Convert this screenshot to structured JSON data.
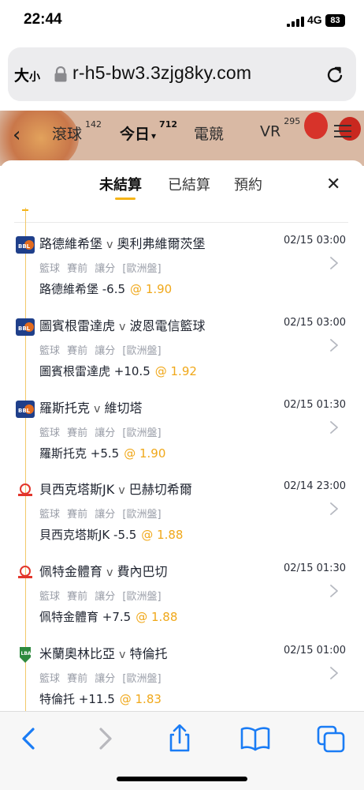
{
  "status": {
    "time": "22:44",
    "network": "4G",
    "battery": "83"
  },
  "browser": {
    "text_size_big": "大",
    "text_size_small": "小",
    "url": "r-h5-bw3.3zjg8ky.com"
  },
  "app_nav": {
    "tabs": [
      {
        "label": "滾球",
        "count": "142"
      },
      {
        "label": "今日",
        "count": "712"
      },
      {
        "label": "電競",
        "count": ""
      },
      {
        "label": "VR",
        "count": "295"
      }
    ]
  },
  "sheet": {
    "tabs": [
      "未結算",
      "已結算",
      "預約"
    ],
    "close": "✕",
    "bets": [
      {
        "home": "路德維希堡",
        "sep": "v",
        "away": "奧利弗維爾茨堡",
        "date": "02/15 03:00",
        "meta": "籃球 賽前 讓分 [歐洲盤]",
        "pick": "路德維希堡 -6.5",
        "odds": "@ 1.90",
        "logo": "bbl-logo"
      },
      {
        "home": "圖賓根雷達虎",
        "sep": "v",
        "away": "波恩電信籃球",
        "date": "02/15 03:00",
        "meta": "籃球 賽前 讓分 [歐洲盤]",
        "pick": "圖賓根雷達虎 +10.5",
        "odds": "@ 1.92",
        "logo": "bbl-logo"
      },
      {
        "home": "羅斯托克",
        "sep": "v",
        "away": "維切塔",
        "date": "02/15 01:30",
        "meta": "籃球 賽前 讓分 [歐洲盤]",
        "pick": "羅斯托克 +5.5",
        "odds": "@ 1.90",
        "logo": "bbl-logo"
      },
      {
        "home": "貝西克塔斯JK",
        "sep": "v",
        "away": "巴赫切希爾",
        "date": "02/14 23:00",
        "meta": "籃球 賽前 讓分 [歐洲盤]",
        "pick": "貝西克塔斯JK -5.5",
        "odds": "@ 1.88",
        "logo": "tbsl-logo"
      },
      {
        "home": "佩特金體育",
        "sep": "v",
        "away": "費內巴切",
        "date": "02/15 01:30",
        "meta": "籃球 賽前 讓分 [歐洲盤]",
        "pick": "佩特金體育 +7.5",
        "odds": "@ 1.88",
        "logo": "tbsl-logo"
      },
      {
        "home": "米蘭奧林比亞",
        "sep": "v",
        "away": "特倫托",
        "date": "02/15 01:00",
        "meta": "籃球 賽前 讓分 [歐洲盤]",
        "pick": "特倫托 +11.5",
        "odds": "@ 1.83",
        "logo": "lba-logo"
      }
    ]
  },
  "colors": {
    "accent": "#f5b418",
    "odds": "#f0a81a",
    "ios_blue": "#1a7cf5"
  },
  "toolbar": {
    "icons": [
      "back-icon",
      "forward-icon",
      "share-icon",
      "bookmarks-icon",
      "tabs-icon"
    ]
  }
}
